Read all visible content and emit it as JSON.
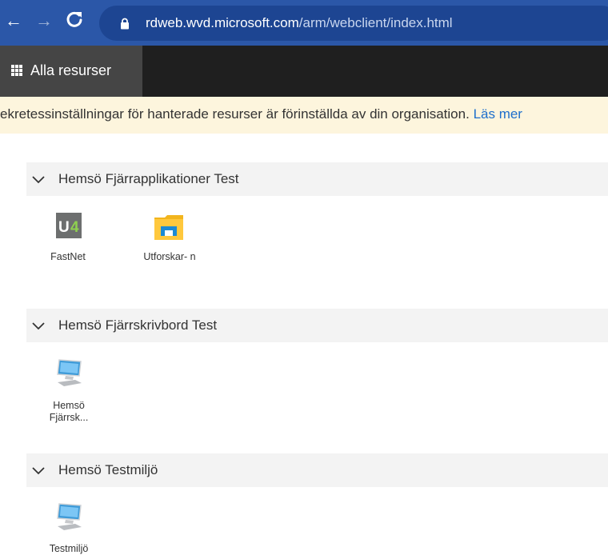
{
  "browser": {
    "url_host": "rdweb.wvd.microsoft.com",
    "url_path": "/arm/webclient/index.html",
    "icons": [
      "back-arrow-icon",
      "forward-arrow-icon",
      "reload-icon",
      "lock-icon"
    ]
  },
  "header": {
    "tab_label": "Alla resurser",
    "tab_icon": "app-launcher-grid-icon"
  },
  "notice": {
    "text": "ekretessinställningar för hanterade resurser är förinställda av din organisation.",
    "link": "Läs mer"
  },
  "groups": [
    {
      "title": "Hemsö Fjärrapplikationer Test",
      "items": [
        {
          "label": "FastNet",
          "icon": "u4-app-icon"
        },
        {
          "label": "Utforskar- n",
          "icon": "file-explorer-icon"
        }
      ]
    },
    {
      "title": "Hemsö Fjärrskrivbord Test",
      "items": [
        {
          "label_line1": "Hemsö",
          "label_line2": "Fjärrsk...",
          "icon": "remote-desktop-icon"
        }
      ]
    },
    {
      "title": "Hemsö Testmiljö",
      "items": [
        {
          "label": "Testmiljö",
          "icon": "remote-desktop-icon"
        }
      ]
    }
  ],
  "colors": {
    "browser_bar": "#2b57a8",
    "app_header": "#1f1f1f",
    "active_tab": "#454545",
    "notice_bg": "#fdf5dd",
    "link": "#1e6fcc",
    "group_header_bg": "#f3f3f3"
  }
}
